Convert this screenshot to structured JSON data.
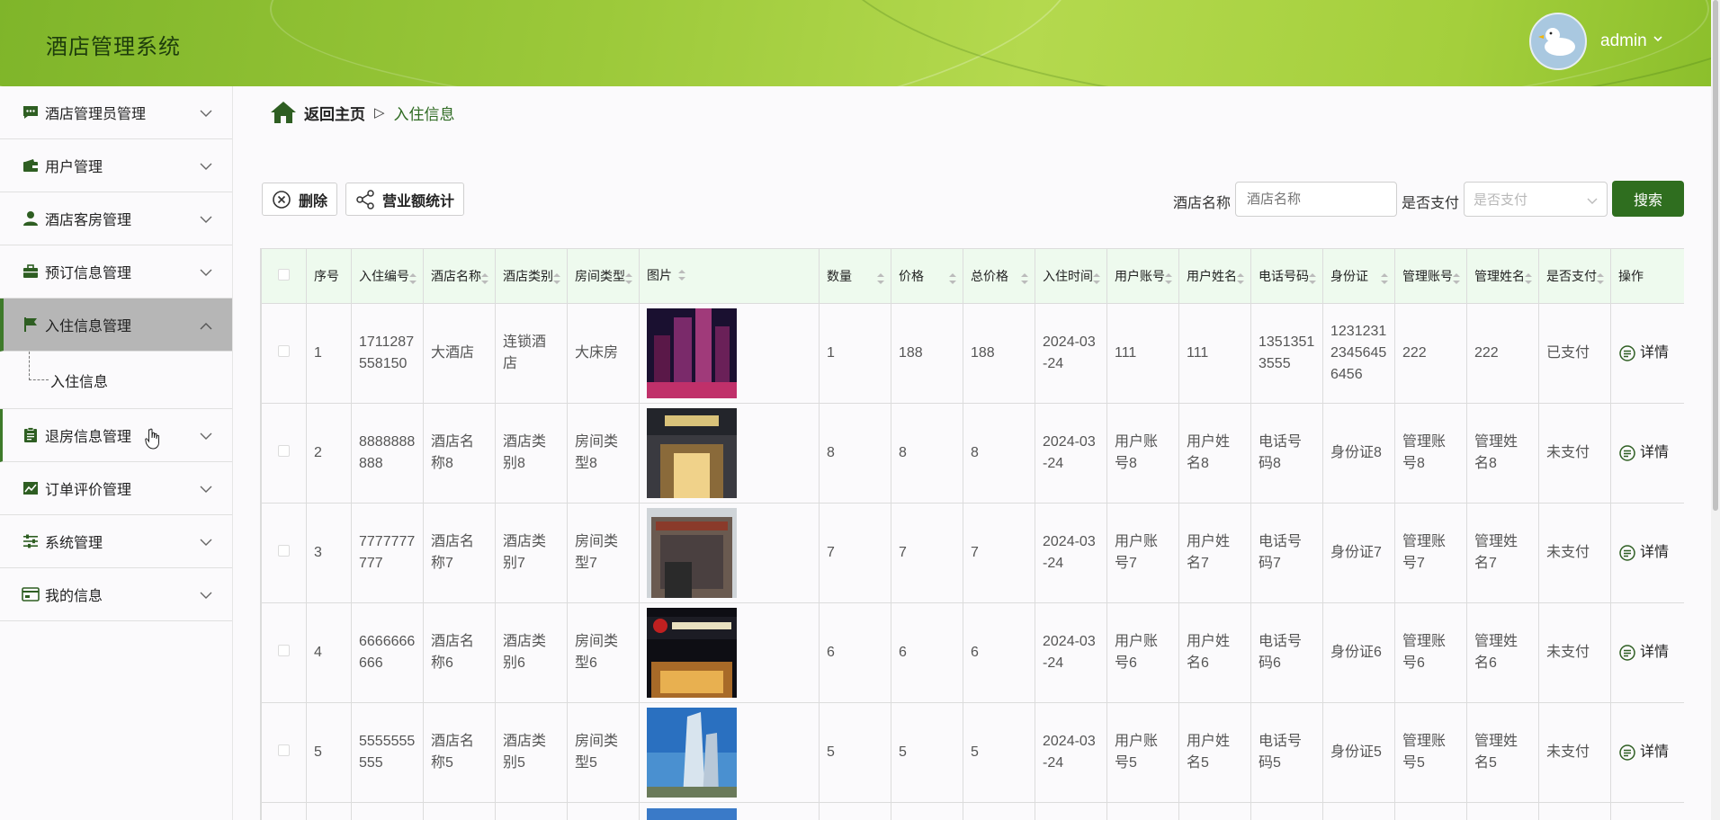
{
  "header": {
    "title": "酒店管理系统",
    "user": "admin"
  },
  "sidebar": {
    "items": [
      {
        "label": "酒店管理员管理",
        "icon": "chat-icon"
      },
      {
        "label": "用户管理",
        "icon": "wallet-icon"
      },
      {
        "label": "酒店客房管理",
        "icon": "person-icon"
      },
      {
        "label": "预订信息管理",
        "icon": "briefcase-icon"
      },
      {
        "label": "入住信息管理",
        "icon": "flag-icon",
        "expanded": true,
        "sub": [
          "入住信息"
        ]
      },
      {
        "label": "退房信息管理",
        "icon": "clipboard-icon"
      },
      {
        "label": "订单评价管理",
        "icon": "chart-icon"
      },
      {
        "label": "系统管理",
        "icon": "sliders-icon"
      },
      {
        "label": "我的信息",
        "icon": "card-icon"
      }
    ]
  },
  "breadcrumb": {
    "home": "返回主页",
    "separator": "▷",
    "current": "入住信息"
  },
  "toolbar": {
    "delete_label": "删除",
    "stats_label": "营业额统计"
  },
  "search": {
    "hotel_label": "酒店名称",
    "hotel_placeholder": "酒店名称",
    "paid_label": "是否支付",
    "paid_placeholder": "是否支付",
    "button": "搜索"
  },
  "table": {
    "columns": [
      "序号",
      "入住编号",
      "酒店名称",
      "酒店类别",
      "房间类型",
      "图片",
      "数量",
      "价格",
      "总价格",
      "入住时间",
      "用户账号",
      "用户姓名",
      "电话号码",
      "身份证",
      "管理账号",
      "管理姓名",
      "是否支付",
      "操作"
    ],
    "detail_label": "详情",
    "rows": [
      {
        "idx": "1",
        "code": "1711287558150",
        "hotel": "大酒店",
        "category": "连锁酒店",
        "room": "大床房",
        "qty": "1",
        "price": "188",
        "total": "188",
        "time": "2024-03-24",
        "account": "111",
        "uname": "111",
        "phone": "13513513555",
        "idcard": "123123123456456456",
        "macct": "222",
        "mname": "222",
        "paid": "已支付"
      },
      {
        "idx": "2",
        "code": "8888888888",
        "hotel": "酒店名称8",
        "category": "酒店类别8",
        "room": "房间类型8",
        "qty": "8",
        "price": "8",
        "total": "8",
        "time": "2024-03-24",
        "account": "用户账号8",
        "uname": "用户姓名8",
        "phone": "电话号码8",
        "idcard": "身份证8",
        "macct": "管理账号8",
        "mname": "管理姓名8",
        "paid": "未支付"
      },
      {
        "idx": "3",
        "code": "7777777777",
        "hotel": "酒店名称7",
        "category": "酒店类别7",
        "room": "房间类型7",
        "qty": "7",
        "price": "7",
        "total": "7",
        "time": "2024-03-24",
        "account": "用户账号7",
        "uname": "用户姓名7",
        "phone": "电话号码7",
        "idcard": "身份证7",
        "macct": "管理账号7",
        "mname": "管理姓名7",
        "paid": "未支付"
      },
      {
        "idx": "4",
        "code": "6666666666",
        "hotel": "酒店名称6",
        "category": "酒店类别6",
        "room": "房间类型6",
        "qty": "6",
        "price": "6",
        "total": "6",
        "time": "2024-03-24",
        "account": "用户账号6",
        "uname": "用户姓名6",
        "phone": "电话号码6",
        "idcard": "身份证6",
        "macct": "管理账号6",
        "mname": "管理姓名6",
        "paid": "未支付"
      },
      {
        "idx": "5",
        "code": "5555555555",
        "hotel": "酒店名称5",
        "category": "酒店类别5",
        "room": "房间类型5",
        "qty": "5",
        "price": "5",
        "total": "5",
        "time": "2024-03-24",
        "account": "用户账号5",
        "uname": "用户姓名5",
        "phone": "电话号码5",
        "idcard": "身份证5",
        "macct": "管理账号5",
        "mname": "管理姓名5",
        "paid": "未支付"
      }
    ]
  },
  "colors": {
    "brand": "#2f6e1f",
    "header_gradient_start": "#7fb52a",
    "header_gradient_end": "#b4d94e",
    "table_header_bg": "#eefaee",
    "active_menu_bg": "#b6b6b6"
  }
}
